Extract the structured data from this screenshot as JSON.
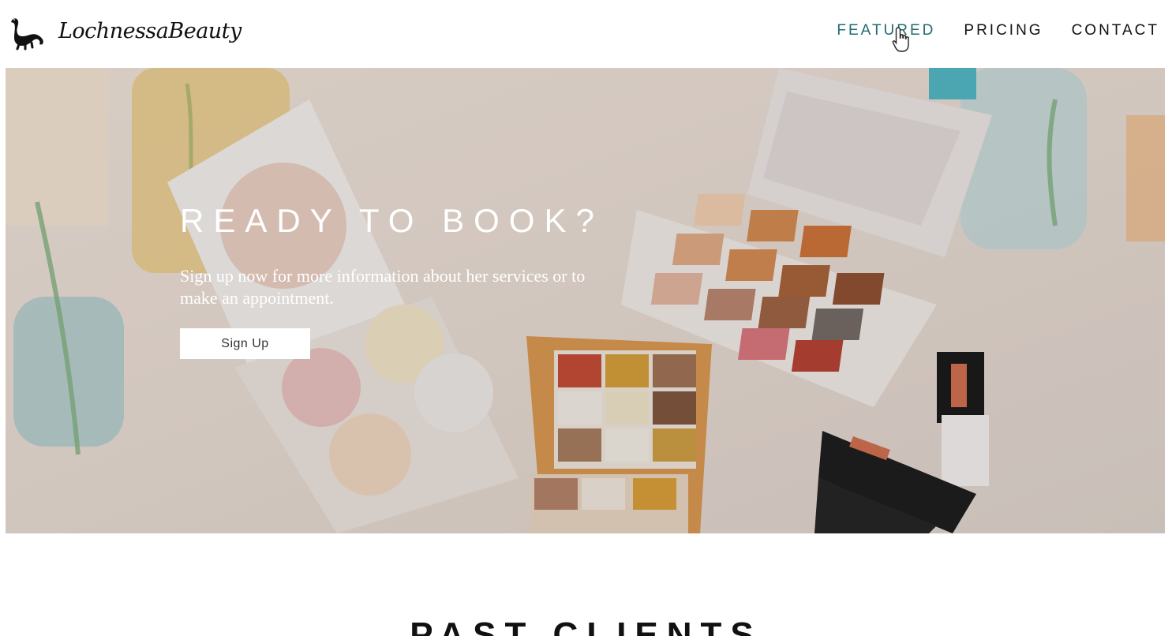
{
  "brand": {
    "name": "LochnessaBeauty",
    "icon": "loch-ness-monster-icon"
  },
  "nav": {
    "items": [
      {
        "label": "FEATURED",
        "active": true
      },
      {
        "label": "PRICING",
        "active": false
      },
      {
        "label": "CONTACT",
        "active": false
      }
    ]
  },
  "hero": {
    "title": "READY TO BOOK?",
    "subtitle": "Sign up now for more information about her services or to make an appointment.",
    "button_label": "Sign Up"
  },
  "next_section": {
    "title": "PAST CLIENTS"
  },
  "colors": {
    "accent": "#1f6b72",
    "text": "#111111",
    "background": "#ffffff"
  }
}
